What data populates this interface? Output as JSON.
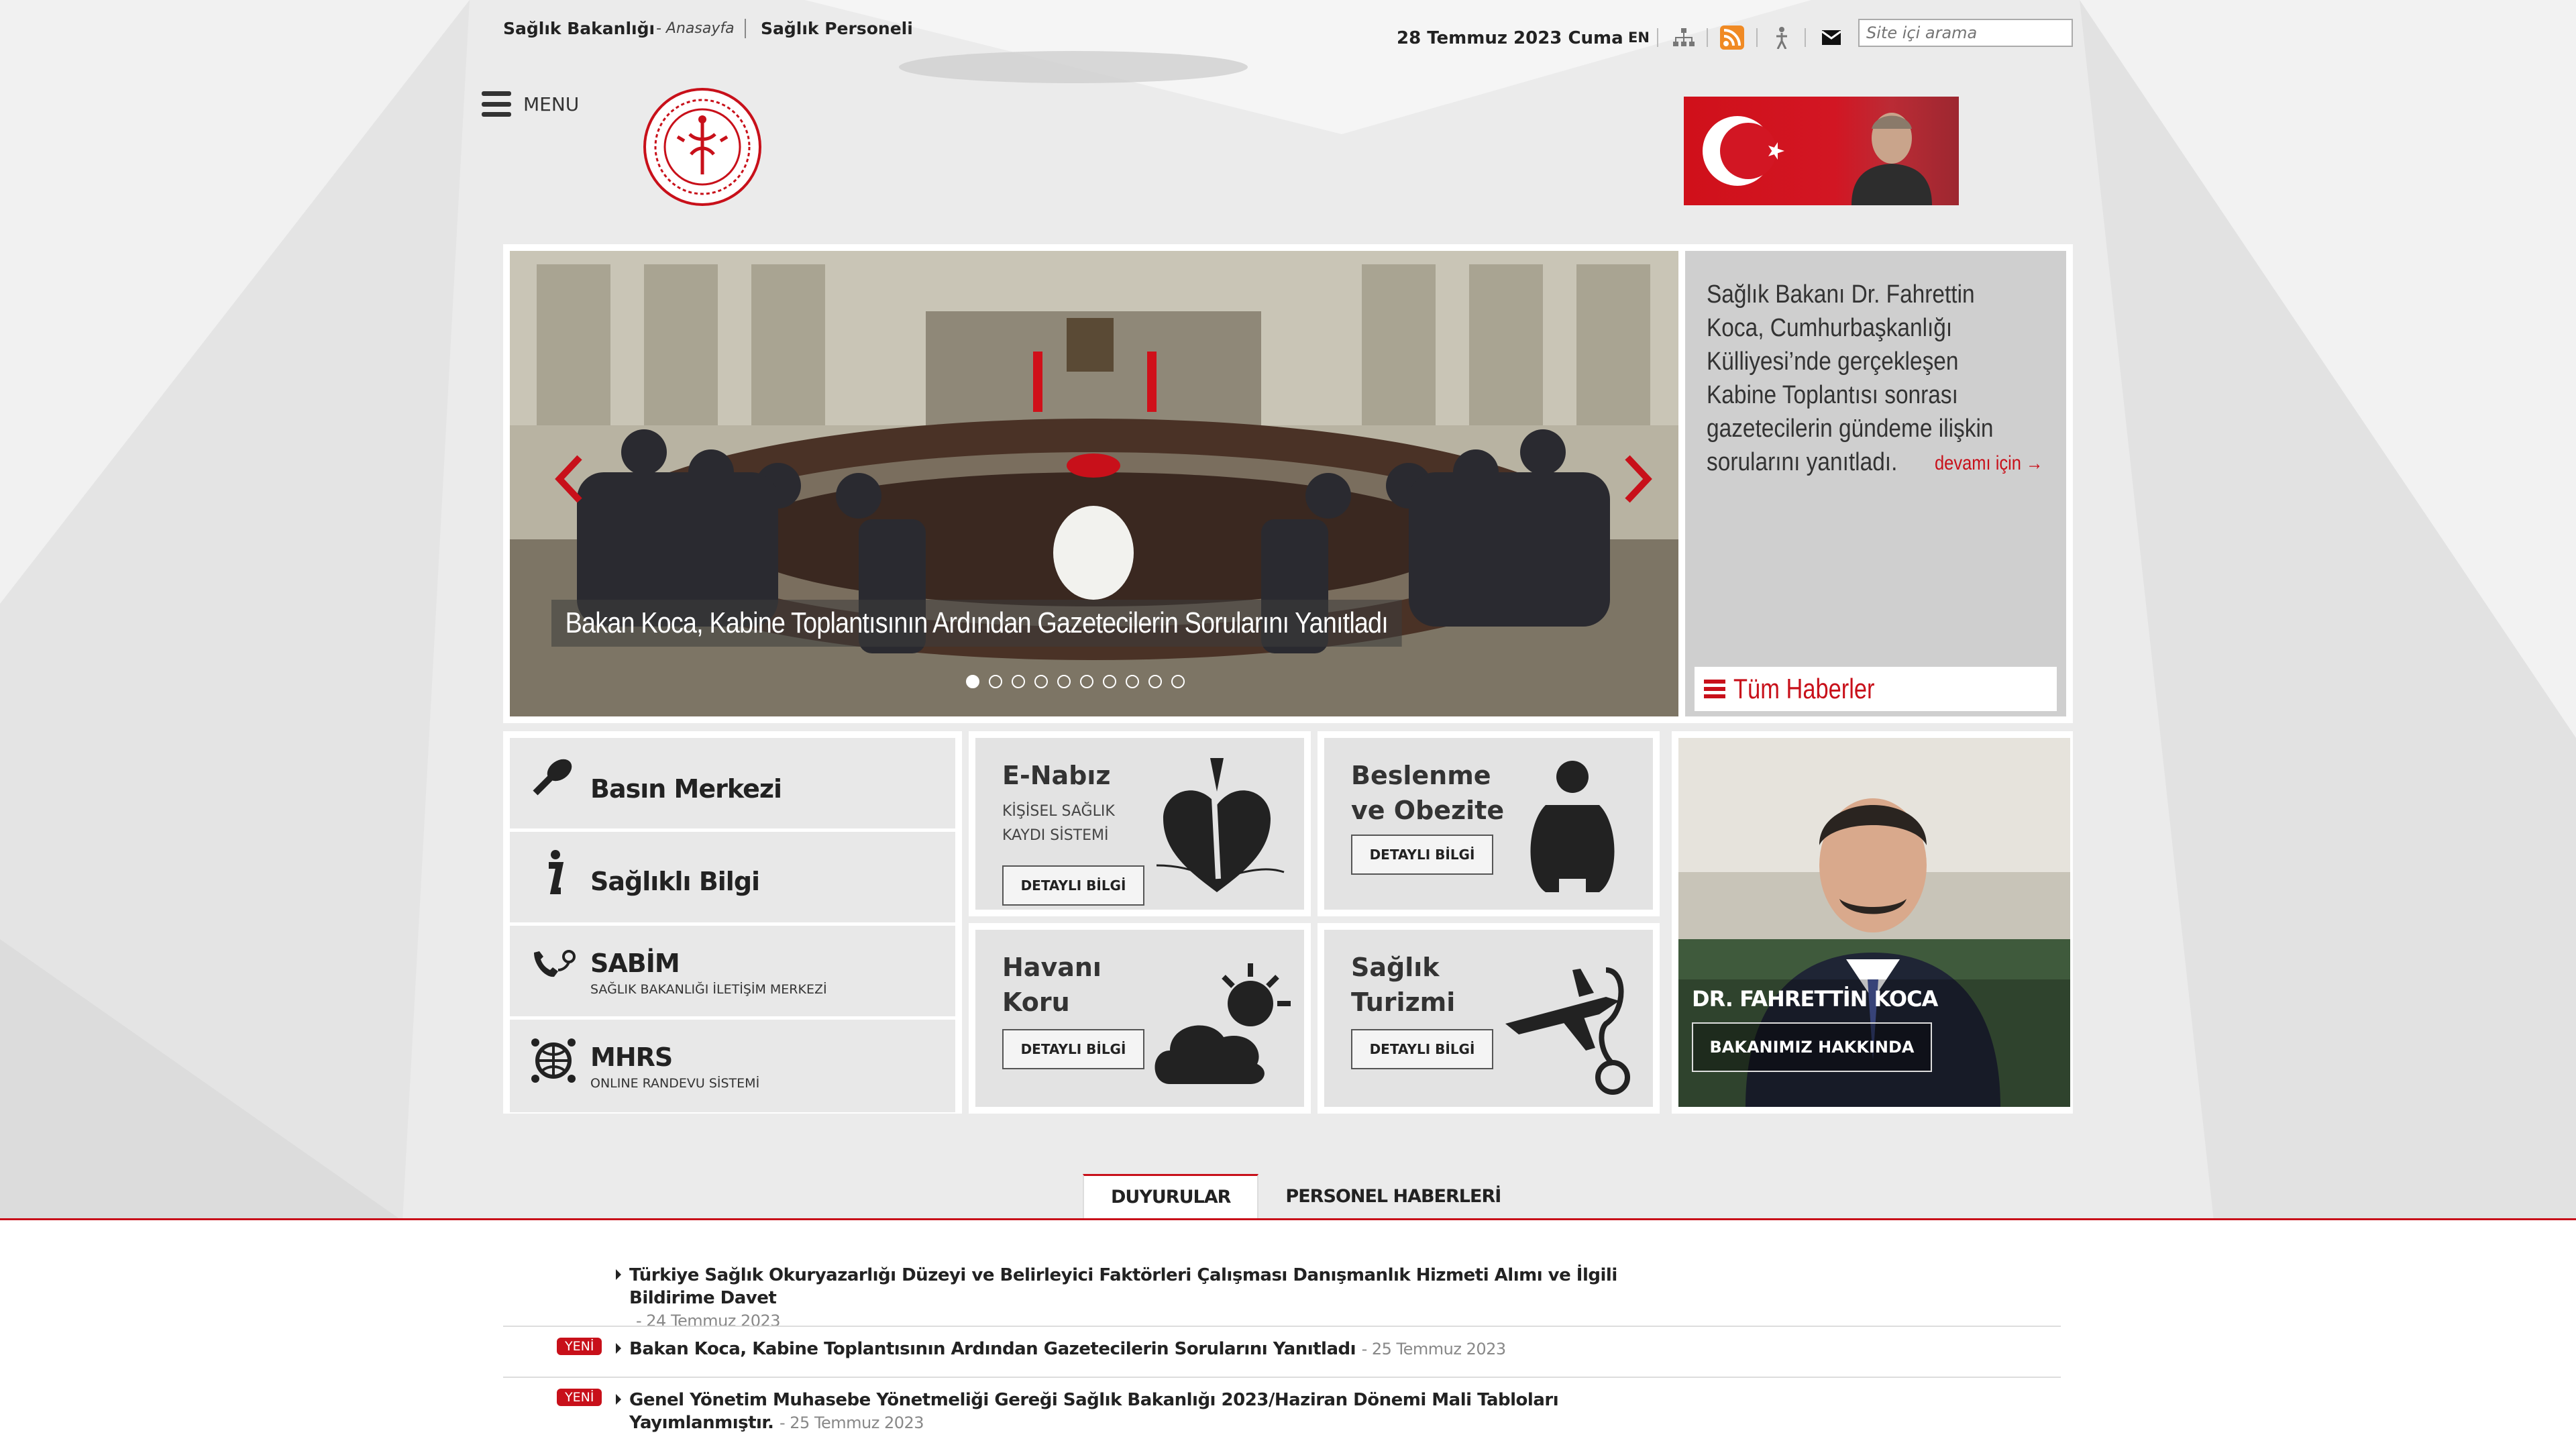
{
  "topbar": {
    "brand": "Sağlık Bakanlığı",
    "home": "- Anasayfa",
    "personel": "Sağlık Personeli",
    "date": "28 Temmuz 2023 Cuma",
    "lang": "EN",
    "search_placeholder": "Site içi arama",
    "icons": [
      "sitemap-icon",
      "rss-icon",
      "accessibility-icon",
      "mail-icon"
    ]
  },
  "header": {
    "menu_label": "MENU"
  },
  "slider": {
    "caption": "Bakan Koca, Kabine Toplantısının Ardından Gazetecilerin Sorularını Yanıtladı",
    "description": "Sağlık Bakanı Dr. Fahrettin Koca, Cumhurbaşkanlığı Külliyesi’nde gerçekleşen Kabine Toplantısı sonrası gazetecilerin gündeme ilişkin sorularını yanıtladı.",
    "more_label": "devamı için →",
    "all_news_label": "Tüm Haberler",
    "dot_count": 10,
    "active_dot": 0
  },
  "quick_links": [
    {
      "title": "Basın Merkezi",
      "sub": "",
      "icon": "microphone-icon"
    },
    {
      "title": "Sağlıklı Bilgi",
      "sub": "",
      "icon": "info-icon"
    },
    {
      "title": "SABİM",
      "sub": "SAĞLIK BAKANLIĞI İLETİŞİM MERKEZİ",
      "icon": "phone-route-icon"
    },
    {
      "title": "MHRS",
      "sub": "ONLINE RANDEVU SİSTEMİ",
      "icon": "globe-network-icon"
    }
  ],
  "tiles": {
    "enabiz": {
      "title": "E-Nabız",
      "sub1": "KİŞİSEL SAĞLIK",
      "sub2": "KAYDI SİSTEMİ",
      "button": "DETAYLI BİLGİ"
    },
    "obesity": {
      "title1": "Beslenme",
      "title2": "ve Obezite",
      "button": "DETAYLI BİLGİ"
    },
    "air": {
      "title1": "Havanı",
      "title2": "Koru",
      "button": "DETAYLI BİLGİ"
    },
    "tourism": {
      "title1": "Sağlık",
      "title2": "Turizmi",
      "button": "DETAYLI BİLGİ"
    }
  },
  "minister": {
    "name": "DR. FAHRETTİN KOCA",
    "about": "BAKANIMIZ HAKKINDA"
  },
  "tabs": [
    "DUYURULAR",
    "PERSONEL HABERLERİ"
  ],
  "news": [
    {
      "title": "Türkiye Sağlık Okuryazarlığı Düzeyi ve Belirleyici Faktörleri Çalışması Danışmanlık Hizmeti Alımı ve İlgili Bildirime Davet",
      "date": "- 24 Temmuz 2023",
      "new": ""
    },
    {
      "title": "Bakan Koca, Kabine Toplantısının Ardından Gazetecilerin Sorularını Yanıtladı",
      "date": "- 25 Temmuz 2023",
      "new": "YENİ"
    },
    {
      "title": "Genel Yönetim Muhasebe Yönetmeliği Gereği Sağlık Bakanlığı 2023/Haziran Dönemi Mali Tabloları Yayımlanmıştır.",
      "date": "- 25 Temmuz 2023",
      "new": "YENİ"
    }
  ],
  "colors": {
    "accent": "#c8101a",
    "tile_bg": "#e3e3e3",
    "page_bg": "#ececec"
  }
}
